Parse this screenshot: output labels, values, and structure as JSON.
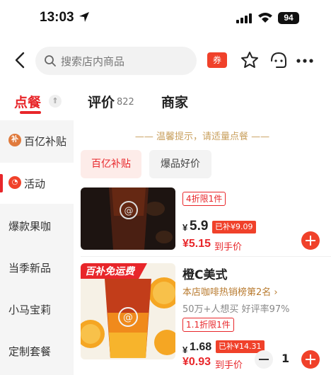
{
  "status_bar": {
    "time": "13:03",
    "battery": "94"
  },
  "nav": {
    "search_placeholder": "搜索店内商品",
    "coupon_label": "券"
  },
  "tabs": [
    {
      "label": "点餐"
    },
    {
      "label": "评价",
      "count": "822"
    },
    {
      "label": "商家"
    }
  ],
  "sidebar": {
    "items": [
      {
        "label": "百亿补贴",
        "icon_text": "补"
      },
      {
        "label": "活动"
      },
      {
        "label": "爆款果咖"
      },
      {
        "label": "当季新品"
      },
      {
        "label": "小马宝莉"
      },
      {
        "label": "定制套餐"
      }
    ]
  },
  "content": {
    "tip": "—— 温馨提示，请适量点餐 ——",
    "chips": [
      "百亿补贴",
      "爆品好价"
    ],
    "products": [
      {
        "deal": "4折限1件",
        "price_symbol": "¥",
        "price": "5.9",
        "subsidy": "已补¥9.09",
        "final_price": "¥5.15",
        "final_label": "到手价"
      },
      {
        "badge": "百补免运费",
        "name": "橙C美式",
        "rank": "本店咖啡热销榜第2名 ›",
        "stats": "50万+人想买  好评率97%",
        "deal": "1.1折限1件",
        "price_symbol": "¥",
        "price": "1.68",
        "subsidy": "已补¥14.31",
        "final_price": "¥0.93",
        "final_label": "到手价",
        "quantity": "1"
      }
    ]
  },
  "colors": {
    "accent": "#e8262a",
    "gold": "#c9a05e"
  }
}
